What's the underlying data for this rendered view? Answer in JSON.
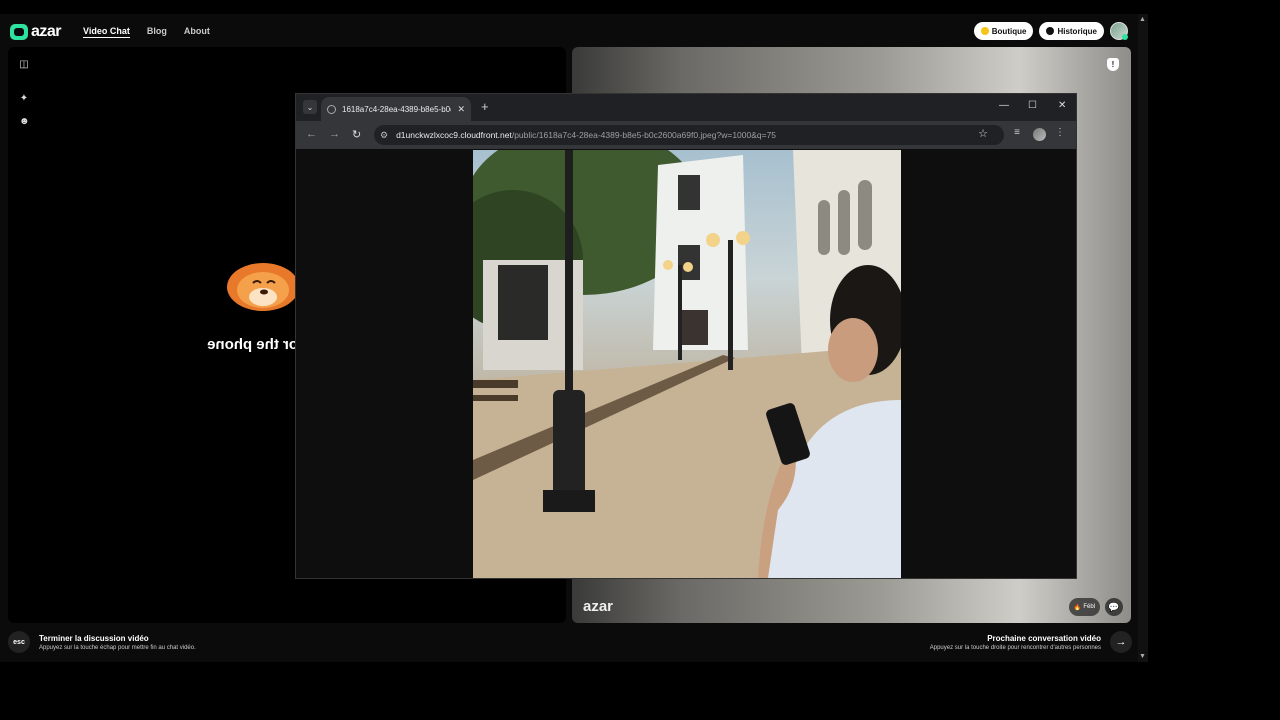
{
  "azar": {
    "logo_text": "azar",
    "nav": [
      "Video Chat",
      "Blog",
      "About"
    ],
    "boutique_label": "Boutique",
    "historique_label": "Historique",
    "mirror_text": "or the phone",
    "watermark": "azar",
    "badge_text": "Fébl",
    "footer_left_key": "esc",
    "footer_left_title": "Terminer la discussion vidéo",
    "footer_left_sub": "Appuyez sur la touche échap pour mettre fin au chat vidéo.",
    "footer_right_title": "Prochaine conversation vidéo",
    "footer_right_sub": "Appuyez sur la touche droite pour rencontrer d'autres personnes",
    "colors": {
      "brand": "#2fe2a0",
      "boutique_dot": "#f5c518"
    }
  },
  "chrome": {
    "tab_title": "1618a7c4-28ea-4389-b8e5-b0c",
    "url_host": "d1unckwzlxcoc9.cloudfront.net",
    "url_path": "/public/1618a7c4-28ea-4389-b8e5-b0c2600a69f0.jpeg?w=1000&q=75",
    "icons": {
      "back": "back-arrow-icon",
      "forward": "forward-arrow-icon",
      "reload": "reload-icon",
      "bookmark": "star-icon"
    }
  }
}
